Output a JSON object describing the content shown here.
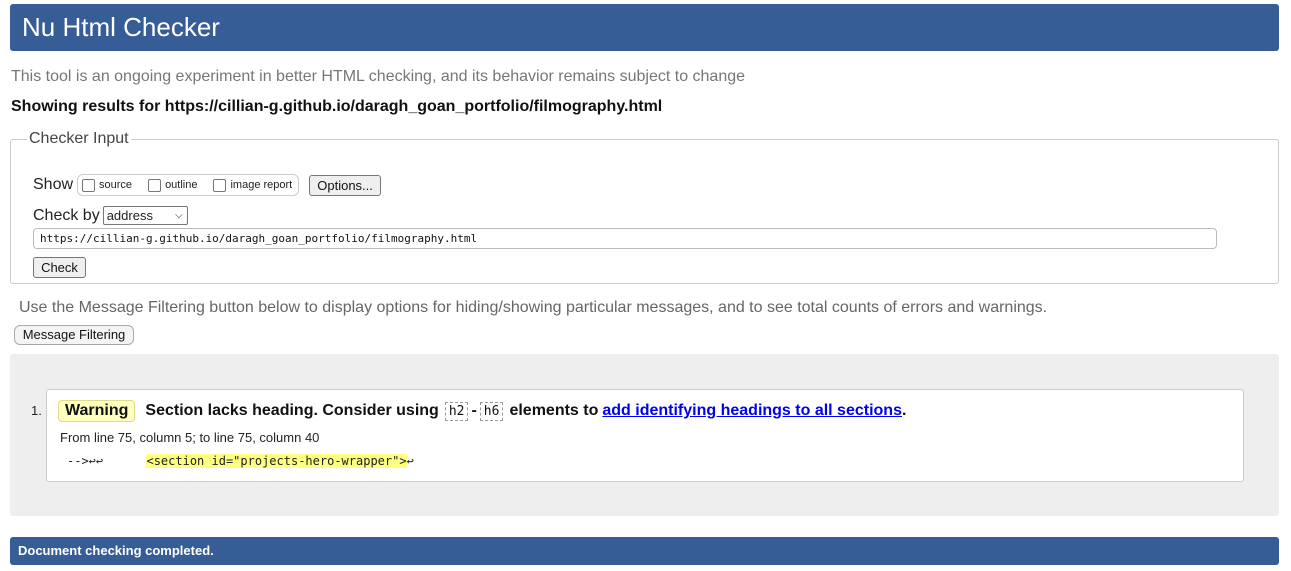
{
  "header": {
    "title": "Nu Html Checker"
  },
  "intro": "This tool is an ongoing experiment in better HTML checking, and its behavior remains subject to change",
  "showing": "Showing results for https://cillian-g.github.io/daragh_goan_portfolio/filmography.html",
  "checker_input": {
    "legend": "Checker Input",
    "show_label": "Show",
    "show_options": [
      "source",
      "outline",
      "image report"
    ],
    "options_button": "Options...",
    "check_by_label": "Check by",
    "check_by_value": "address",
    "url_value": "https://cillian-g.github.io/daragh_goan_portfolio/filmography.html",
    "check_button": "Check"
  },
  "filter_hint": "Use the Message Filtering button below to display options for hiding/showing particular messages, and to see total counts of errors and warnings.",
  "filter_button": "Message Filtering",
  "messages": [
    {
      "number": "1.",
      "type": "Warning",
      "text_before": "Section lacks heading. Consider using",
      "code_a": "h2",
      "dash": "-",
      "code_b": "h6",
      "text_after": "elements to",
      "link": "add identifying headings to all sections",
      "period": ".",
      "location": "From line 75, column 5; to line 75, column 40",
      "extract_prefix": "-->↩↩      ",
      "extract_highlight": "<section id=\"projects-hero-wrapper\">",
      "extract_suffix": "↩"
    }
  ],
  "footer": "Document checking completed.",
  "colors": {
    "accent": "#365d95",
    "warning_bg": "#ffffc0",
    "highlight": "#ffff80"
  }
}
